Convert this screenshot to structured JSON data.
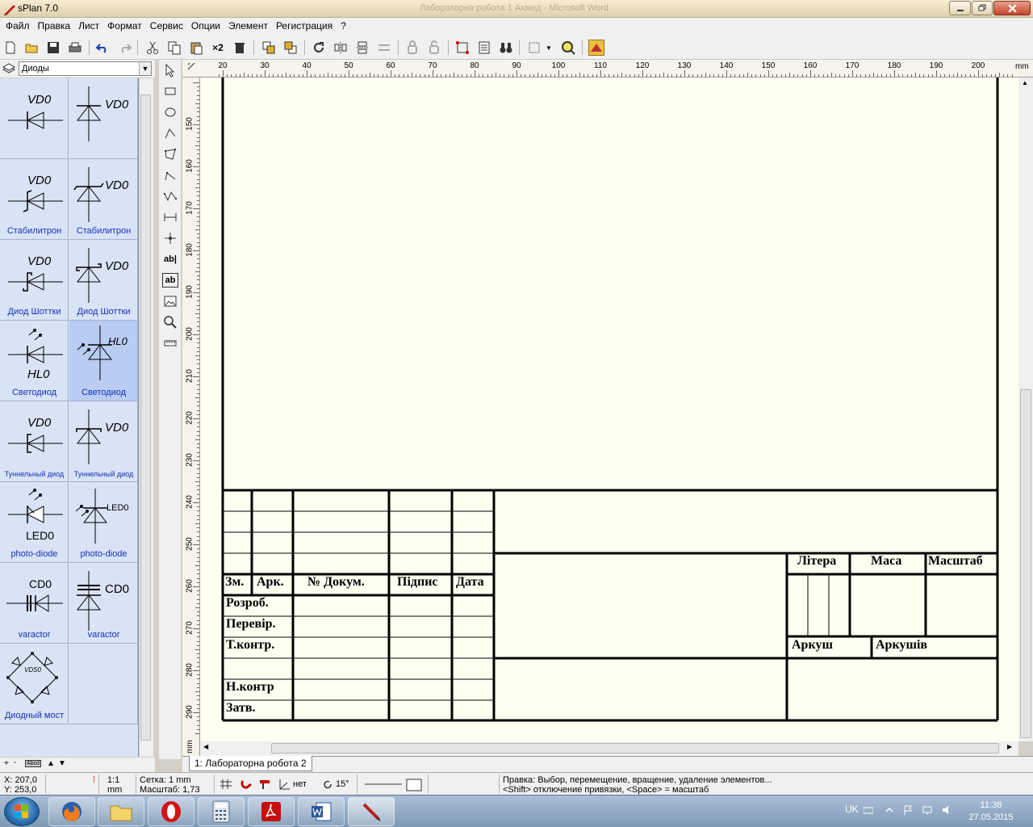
{
  "window": {
    "title": "sPlan 7.0",
    "background_title": "Лабораторна робота 1 Ахмед - Microsoft Word"
  },
  "menu": [
    "Файл",
    "Правка",
    "Лист",
    "Формат",
    "Сервис",
    "Опции",
    "Элемент",
    "Регистрация",
    "?"
  ],
  "toolbar": {
    "duplicate_label": "×2"
  },
  "library": {
    "selected": "Диоды",
    "items": [
      {
        "ref": "VD0",
        "label": "",
        "kind": "diode-h"
      },
      {
        "ref": "VD0",
        "label": "",
        "kind": "diode-v"
      },
      {
        "ref": "VD0",
        "label": "Стабилитрон",
        "kind": "zener-h"
      },
      {
        "ref": "VD0",
        "label": "Стабилитрон",
        "kind": "zener-v"
      },
      {
        "ref": "VD0",
        "label": "Диод Шоттки",
        "kind": "schottky-h"
      },
      {
        "ref": "VD0",
        "label": "Диод Шоттки",
        "kind": "schottky-v"
      },
      {
        "ref": "HL0",
        "label": "Светодиод",
        "kind": "led-h"
      },
      {
        "ref": "HL0",
        "label": "Светодиод",
        "kind": "led-v"
      },
      {
        "ref": "VD0",
        "label": "Туннельный диод",
        "kind": "tunnel-h"
      },
      {
        "ref": "VD0",
        "label": "Туннельный диод",
        "kind": "tunnel-v"
      },
      {
        "ref": "LED0",
        "label": "photo-diode",
        "kind": "photo-h"
      },
      {
        "ref": "LED0",
        "label": "photo-diode",
        "kind": "photo-v"
      },
      {
        "ref": "CD0",
        "label": "varactor",
        "kind": "varactor-h"
      },
      {
        "ref": "CD0",
        "label": "varactor",
        "kind": "varactor-v"
      },
      {
        "ref": "VDS0",
        "label": "Диодный мост",
        "kind": "bridge"
      }
    ],
    "selected_index": 7,
    "bottom_buttons": [
      "+",
      "-",
      "Abcd",
      "▲",
      "▼"
    ]
  },
  "tools": {
    "text_label": "ab|",
    "text_frame_label": "ab"
  },
  "ruler": {
    "top": [
      "20",
      "30",
      "40",
      "50",
      "60",
      "70",
      "80",
      "90",
      "100",
      "110",
      "120",
      "130",
      "140",
      "150",
      "160",
      "170",
      "180",
      "190",
      "200"
    ],
    "top_unit": "mm",
    "left": [
      "150",
      "160",
      "170",
      "180",
      "190",
      "200",
      "210",
      "220",
      "230",
      "240",
      "250",
      "260",
      "270",
      "280",
      "290"
    ],
    "left_unit": "mm"
  },
  "stamp": {
    "headers": {
      "zm": "Зм.",
      "ark": "Арк.",
      "doc": "№ Докум.",
      "sign": "Підпис",
      "date": "Дата"
    },
    "rows": {
      "dev": "Розроб.",
      "check": "Перевір.",
      "tcontr": "Т.контр.",
      "ncontr": "Н.контр",
      "approved": "Затв."
    },
    "right": {
      "litera": "Літера",
      "mass": "Маса",
      "scale": "Масштаб",
      "sheet": "Аркуш",
      "sheets": "Аркушів"
    }
  },
  "sheet_tab": "1: Лабораторна робота 2",
  "status": {
    "x": "X: 207,0",
    "y": "Y: 253,0",
    "ratio": "1:1",
    "unit": "mm",
    "grid": "Сетка: 1 mm",
    "scale": "Масштаб:  1,73",
    "angle_label": "нет",
    "rotation": "15°",
    "hint1": "Правка: Выбор, перемещение, вращение, удаление элементов...",
    "hint2": "<Shift> отключение привязки, <Space> = масштаб"
  },
  "taskbar": {
    "lang": "UK",
    "time": "11:38",
    "date": "27.05.2015"
  },
  "colors": {
    "canvas": "#fffff2",
    "library": "#d8e3f6",
    "library_selected": "#b9ccf2",
    "label_blue": "#1630b8"
  }
}
